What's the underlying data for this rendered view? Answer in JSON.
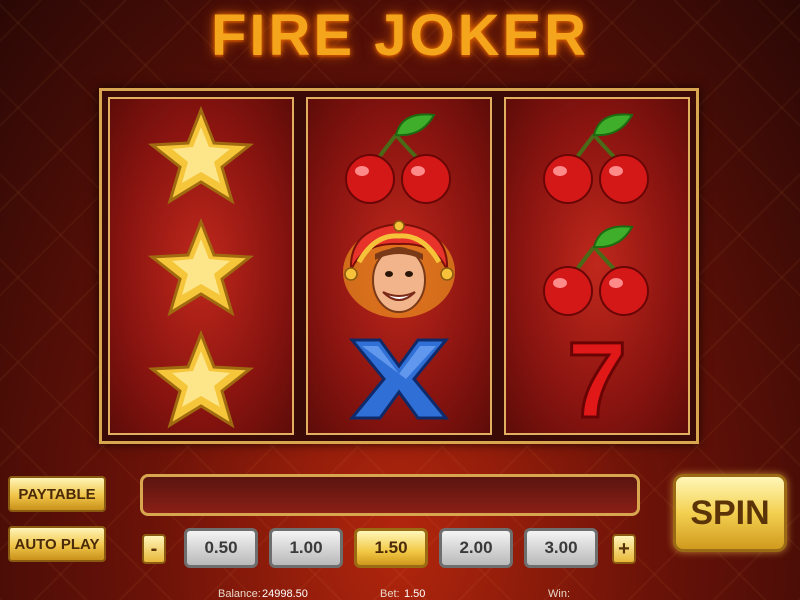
{
  "title": "FIRE JOKER",
  "reels": [
    [
      "star-symbol",
      "star-symbol",
      "star-symbol"
    ],
    [
      "cherry-symbol",
      "joker-symbol",
      "x-symbol"
    ],
    [
      "cherry-symbol",
      "cherry-symbol",
      "seven-symbol"
    ]
  ],
  "seven_glyph": "7",
  "buttons": {
    "paytable": "PAYTABLE",
    "autoplay": "AUTO PLAY",
    "spin": "SPIN",
    "decrease": "-",
    "increase": "+"
  },
  "bets": [
    "0.50",
    "1.00",
    "1.50",
    "2.00",
    "3.00"
  ],
  "selected_bet": "1.50",
  "status": {
    "balance_label": "Balance:",
    "balance_value": "24998.50",
    "bet_label": "Bet:",
    "bet_value": "1.50",
    "win_label": "Win:",
    "win_value": ""
  },
  "colors": {
    "title": "#f5a51c",
    "reel_background": "#8a1410",
    "frame": "#d9a650",
    "active_bet": "#f2c846"
  }
}
